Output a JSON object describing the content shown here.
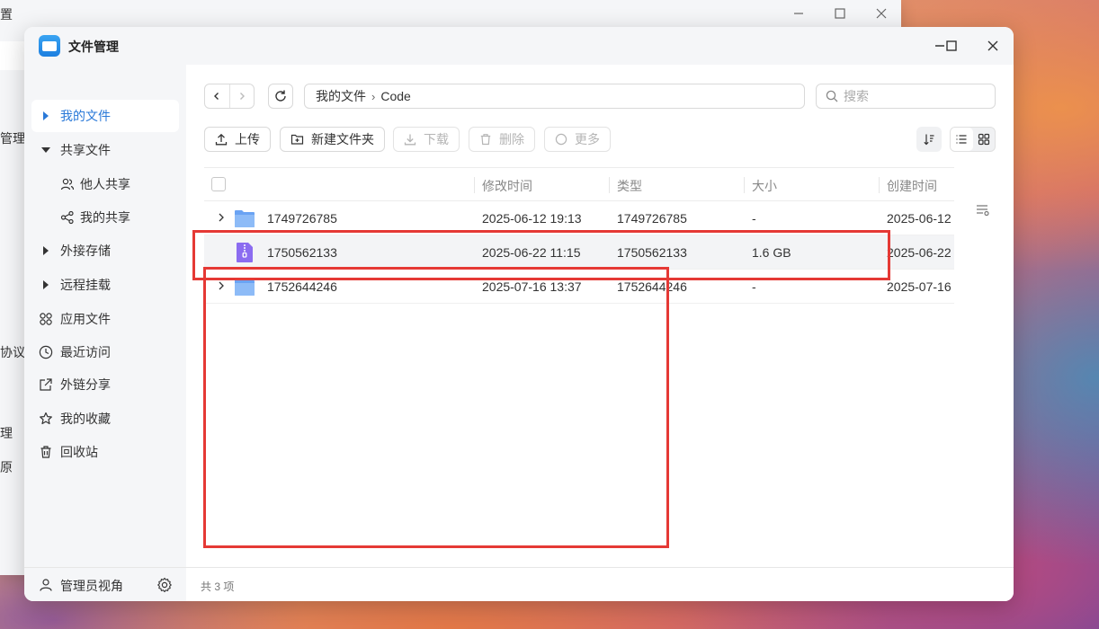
{
  "background_window": {
    "title_fragment": "置",
    "side_fragments": [
      "管理",
      "协议",
      "理",
      "原"
    ]
  },
  "window": {
    "title": "文件管理",
    "controls": {
      "minimize": "minimize-icon",
      "maximize": "maximize-icon",
      "close": "close-icon"
    }
  },
  "sidebar": {
    "items": [
      {
        "label": "我的文件",
        "icon": "caret-right-icon",
        "active": true
      },
      {
        "label": "共享文件",
        "icon": "caret-down-icon"
      },
      {
        "label": "他人共享",
        "icon": "people-icon",
        "sub": true
      },
      {
        "label": "我的共享",
        "icon": "share-nodes-icon",
        "sub": true
      },
      {
        "label": "外接存储",
        "icon": "caret-right-icon"
      },
      {
        "label": "远程挂载",
        "icon": "caret-right-icon"
      },
      {
        "label": "应用文件",
        "icon": "apps-icon"
      },
      {
        "label": "最近访问",
        "icon": "clock-icon"
      },
      {
        "label": "外链分享",
        "icon": "link-share-icon"
      },
      {
        "label": "我的收藏",
        "icon": "star-icon"
      },
      {
        "label": "回收站",
        "icon": "trash-icon"
      }
    ],
    "footer": {
      "label": "管理员视角",
      "settings_icon": "gear-icon"
    }
  },
  "toolbar": {
    "breadcrumb": [
      "我的文件",
      "Code"
    ],
    "search_placeholder": "搜索",
    "buttons": {
      "upload": "上传",
      "new_folder": "新建文件夹",
      "download": "下载",
      "delete": "删除",
      "more": "更多"
    }
  },
  "table": {
    "columns": [
      "修改时间",
      "类型",
      "大小",
      "创建时间"
    ],
    "rows": [
      {
        "name": "1749726785",
        "modified": "2025-06-12 19:13",
        "type": "1749726785",
        "size": "-",
        "created": "2025-06-12",
        "kind": "folder"
      },
      {
        "name": "1750562133",
        "modified": "2025-06-22 11:15",
        "type": "1750562133",
        "size": "1.6 GB",
        "created": "2025-06-22",
        "kind": "archive"
      },
      {
        "name": "1752644246",
        "modified": "2025-07-16 13:37",
        "type": "1752644246",
        "size": "-",
        "created": "2025-07-16",
        "kind": "folder"
      }
    ]
  },
  "status": {
    "count_text": "共 3 项"
  },
  "colors": {
    "accent": "#2a79d8",
    "folder": "#7fb2f5",
    "archive": "#8b6cf0",
    "annotation": "#e53935"
  }
}
